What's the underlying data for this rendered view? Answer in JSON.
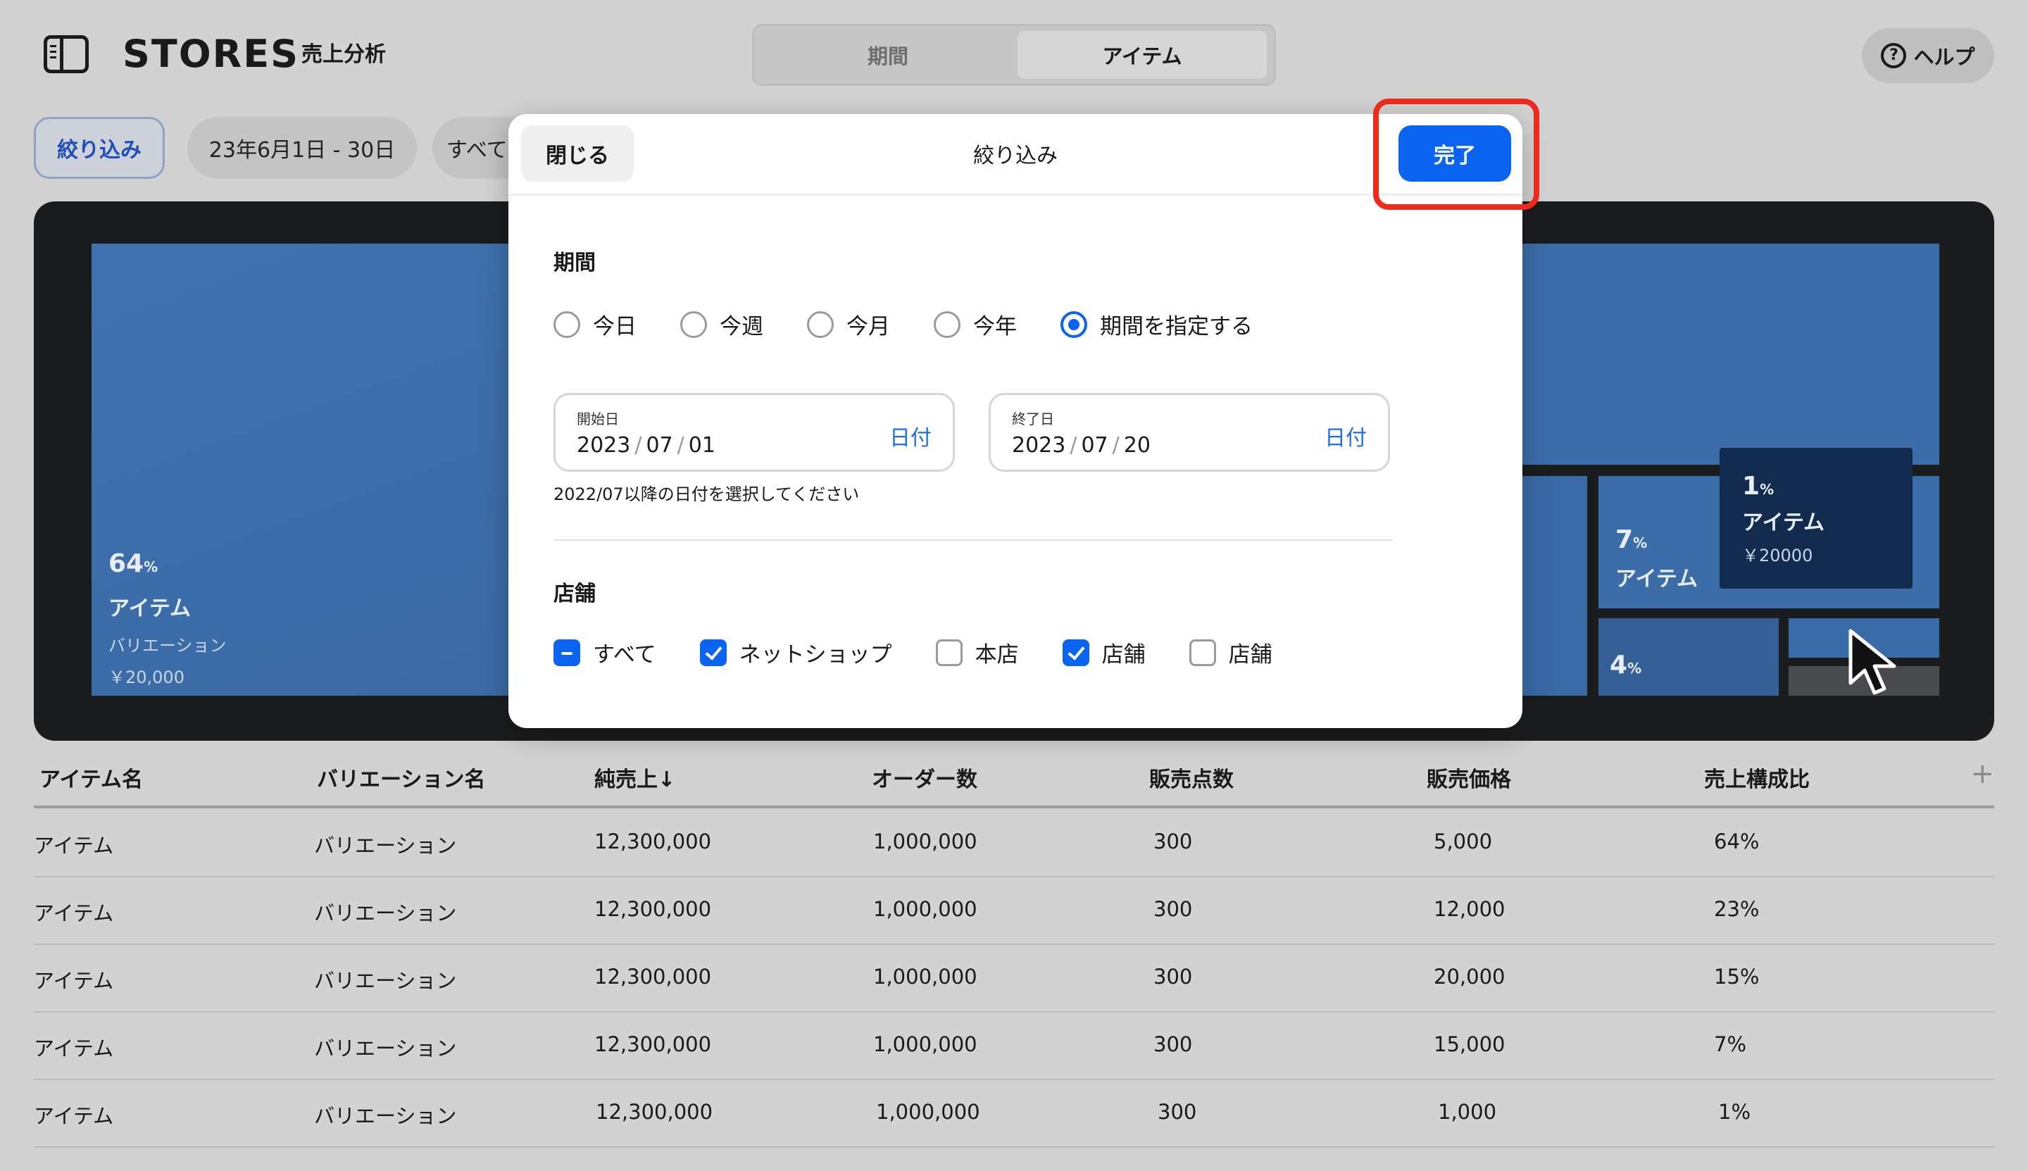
{
  "header": {
    "brand": "STORES",
    "subtitle": "売上分析",
    "segments": [
      "期間",
      "アイテム"
    ],
    "active_segment": "アイテム",
    "help_label": "ヘルプ"
  },
  "filters": {
    "filter_label": "絞り込み",
    "date_range": "23年6月1日 - 30日",
    "stores": "すべて"
  },
  "treemap": {
    "main": {
      "percent": "64",
      "unit": "%",
      "name": "アイテム",
      "variation": "バリエーション",
      "amount": "￥20,000"
    },
    "tile_7": {
      "percent": "7",
      "unit": "%",
      "name": "アイテム"
    },
    "tile_4": {
      "percent": "4",
      "unit": "%"
    },
    "tooltip": {
      "percent": "1",
      "unit": "%",
      "name": "アイテム",
      "amount": "￥20000"
    },
    "colors": {
      "tile": "#3c6da9",
      "panel": "#1b1c1e",
      "tooltip": "#142b50"
    }
  },
  "table": {
    "columns": [
      "アイテム名",
      "バリエーション名",
      "純売上↓",
      "オーダー数",
      "販売点数",
      "販売価格",
      "売上構成比"
    ],
    "rows": [
      [
        "アイテム",
        "バリエーション",
        "12,300,000",
        "1,000,000",
        "300",
        "5,000",
        "64%"
      ],
      [
        "アイテム",
        "バリエーション",
        "12,300,000",
        "1,000,000",
        "300",
        "12,000",
        "23%"
      ],
      [
        "アイテム",
        "バリエーション",
        "12,300,000",
        "1,000,000",
        "300",
        "20,000",
        "15%"
      ],
      [
        "アイテム",
        "バリエーション",
        "12,300,000",
        "1,000,000",
        "300",
        "15,000",
        "7%"
      ],
      [
        "アイテム",
        "バリエーション",
        "12,300,000",
        "1,000,000",
        "300",
        "1,000",
        "1%"
      ]
    ],
    "add_column_icon": "plus-icon"
  },
  "modal": {
    "close_label": "閉じる",
    "title": "絞り込み",
    "done_label": "完了",
    "period": {
      "title": "期間",
      "options": [
        "今日",
        "今週",
        "今月",
        "今年",
        "期間を指定する"
      ],
      "selected": "期間を指定する",
      "start": {
        "label": "開始日",
        "year": "2023",
        "month": "07",
        "day": "01",
        "link": "日付"
      },
      "end": {
        "label": "終了日",
        "year": "2023",
        "month": "07",
        "day": "20",
        "link": "日付"
      },
      "hint": "2022/07以降の日付を選択してください"
    },
    "stores": {
      "title": "店舗",
      "options": [
        {
          "label": "すべて",
          "state": "indeterminate"
        },
        {
          "label": "ネットショップ",
          "state": "checked"
        },
        {
          "label": "本店",
          "state": "unchecked"
        },
        {
          "label": "店舗",
          "state": "checked"
        },
        {
          "label": "店舗",
          "state": "unchecked"
        }
      ]
    },
    "accent_color": "#0a64f0",
    "highlight_color": "#ee2a1d"
  }
}
